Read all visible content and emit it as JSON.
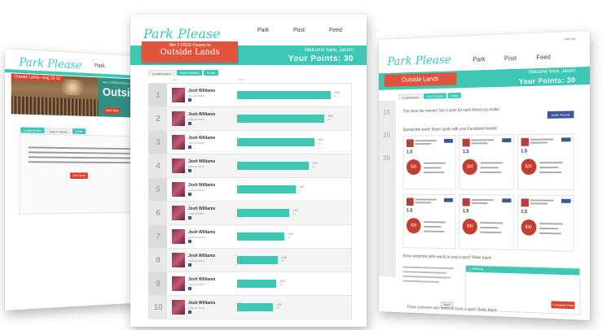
{
  "brand": "Park Please",
  "nav": [
    "Park",
    "Post",
    "Feed"
  ],
  "promo": {
    "line1": "Win 2 FREE Passes to",
    "line2": "Outside Lands",
    "outside_word": "Outside",
    "start": "Start Now",
    "countdown": "Outside Lands • Aug 10-12"
  },
  "user": {
    "welcome": "Welcome back, Jason!",
    "points": "Your Points: 30"
  },
  "tabs": [
    "Leaderboard",
    "How It Works",
    "Invite"
  ],
  "left_page": {
    "join_label": "Join Now!"
  },
  "leaderboard_header": {
    "rank": "",
    "user": "user",
    "points": "points"
  },
  "leaderboard": [
    {
      "rank": "1",
      "name": "Josh Williams",
      "loc": "Oakland 94607",
      "points": "198",
      "unit": "pts",
      "fraction": 0.96
    },
    {
      "rank": "2",
      "name": "Josh Williams",
      "loc": "Oakland 94607",
      "points": "185",
      "unit": "pts",
      "fraction": 0.89
    },
    {
      "rank": "3",
      "name": "Josh Williams",
      "loc": "Oakland 94607",
      "points": "169",
      "unit": "pts",
      "fraction": 0.79
    },
    {
      "rank": "4",
      "name": "Josh Williams",
      "loc": "Oakland 94607",
      "points": "170",
      "unit": "pts",
      "fraction": 0.73
    },
    {
      "rank": "5",
      "name": "Josh Williams",
      "loc": "Oakland 94607",
      "points": "150",
      "unit": "pts",
      "fraction": 0.6
    },
    {
      "rank": "6",
      "name": "Josh Williams",
      "loc": "Oakland 94607",
      "points": "143",
      "unit": "pts",
      "fraction": 0.53
    },
    {
      "rank": "7",
      "name": "Josh Williams",
      "loc": "Oakland 94607",
      "points": "139",
      "unit": "pts",
      "fraction": 0.48
    },
    {
      "rank": "8",
      "name": "Josh Williams",
      "loc": "Oakland 94607",
      "points": "138",
      "unit": "pts",
      "fraction": 0.42
    },
    {
      "rank": "9",
      "name": "Josh Williams",
      "loc": "Oakland 94607",
      "points": "130",
      "unit": "pts",
      "fraction": 0.4
    },
    {
      "rank": "10",
      "name": "Josh Williams",
      "loc": "Oakland 94607",
      "points": "125",
      "unit": "pts",
      "fraction": 0.37
    }
  ],
  "right_page": {
    "top_mini": "Sign out",
    "invite_text": "The more the merrier! Get a point for each friend you invite!",
    "fb_invite": "Invite Friends",
    "spread_text": "Spread the word! Share spots with your Facebook friends!",
    "rates": [
      "1.5",
      "1.5",
      "1.5",
      "1.5",
      "1.5",
      "1.5"
    ],
    "badges": [
      "$30",
      "$30",
      "$30",
      "$30",
      "$30",
      "$30"
    ],
    "know_text": "Know someone who wants to post a spot? Refer them!",
    "form_head": "1. Referral",
    "complete": "Complete Post",
    "back": "Back",
    "bottom_text": "Know someone who wants to book a spot? Refer them!",
    "side_nums": [
      "10",
      "20",
      "30"
    ]
  },
  "colors": {
    "teal": "#3cc8b4",
    "red": "#e0533d",
    "facebook": "#3b5998"
  }
}
